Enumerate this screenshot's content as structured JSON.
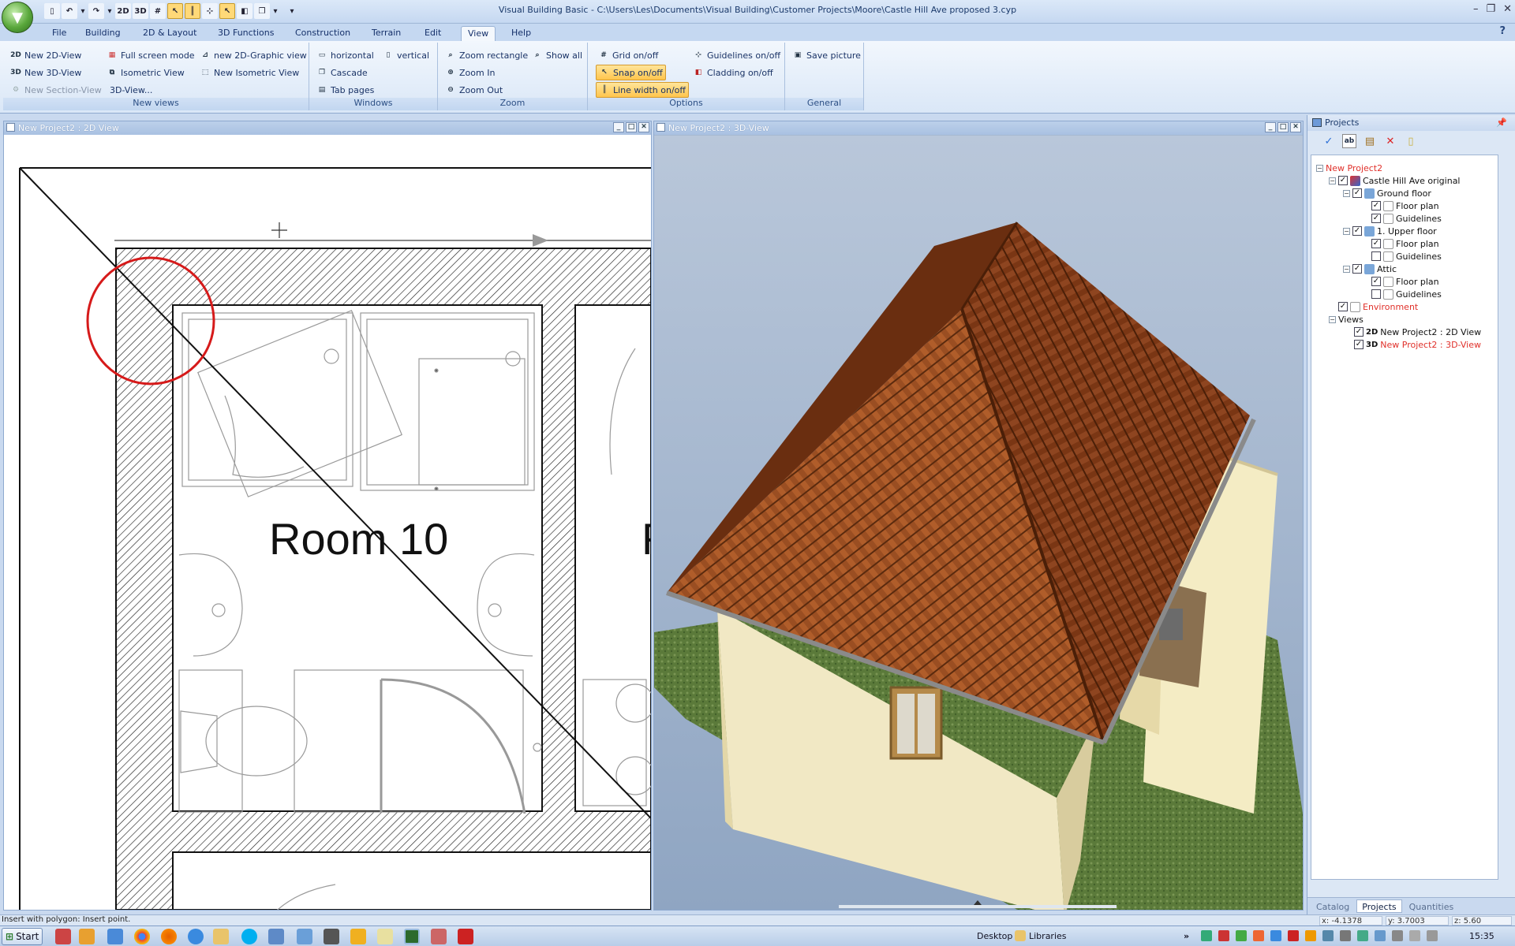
{
  "window": {
    "title": "Visual Building Basic - C:\\Users\\Les\\Documents\\Visual Building\\Customer Projects\\Moore\\Castle Hill Ave proposed 3.cyp"
  },
  "quick_access": [
    "new",
    "undo",
    "undo-arrow",
    "redo",
    "redo-arrow",
    "separator",
    "2D",
    "3D",
    "grid",
    "select-snap",
    "line-width",
    "measure",
    "pointer",
    "cladding",
    "copy",
    "copy-arrow",
    "customize"
  ],
  "menu_tabs": [
    "File",
    "Building",
    "2D & Layout",
    "3D Functions",
    "Construction",
    "Terrain",
    "Edit",
    "View",
    "Help"
  ],
  "active_tab": "View",
  "ribbon": {
    "new_views": {
      "label": "New views",
      "new_2d": "New 2D-View",
      "new_3d": "New 3D-View",
      "new_section": "New Section-View",
      "full_screen": "Full screen mode",
      "isometric": "Isometric View",
      "view_3d": "3D-View...",
      "new_2d_graphic": "new 2D-Graphic view",
      "new_isometric": "New Isometric View"
    },
    "windows": {
      "label": "Windows",
      "horizontal": "horizontal",
      "vertical": "vertical",
      "cascade": "Cascade",
      "tab_pages": "Tab pages"
    },
    "zoom": {
      "label": "Zoom",
      "zoom_rect": "Zoom rectangle",
      "show_all": "Show all",
      "zoom_in": "Zoom In",
      "zoom_out": "Zoom Out"
    },
    "options": {
      "label": "Options",
      "grid": "Grid on/off",
      "guidelines": "Guidelines on/off",
      "snap": "Snap on/off",
      "cladding": "Cladding on/off",
      "line_width": "Line width on/off"
    },
    "general": {
      "label": "General",
      "save_picture": "Save picture"
    }
  },
  "view2d": {
    "title": "New Project2 : 2D View",
    "room_label": "Room 10",
    "partial_label": "R"
  },
  "view3d": {
    "title": "New Project2 : 3D-View"
  },
  "projects": {
    "title": "Projects",
    "tree": {
      "root": "New Project2",
      "project": "Castle Hill Ave original",
      "ground_floor": "Ground floor",
      "upper_floor": "1. Upper floor",
      "attic": "Attic",
      "floor_plan": "Floor plan",
      "guidelines": "Guidelines",
      "environment": "Environment",
      "views": "Views",
      "view_2d_tag": "2D",
      "view_2d": "New Project2 : 2D View",
      "view_3d_tag": "3D",
      "view_3d": "New Project2 : 3D-View"
    },
    "tabs": [
      "Catalog",
      "Projects",
      "Quantities"
    ],
    "active_tab": "Projects"
  },
  "status": {
    "message": "Insert with polygon: Insert point.",
    "x": "x: -4.1378",
    "y": "y: 3.7003",
    "z": "z: 5.60"
  },
  "taskbar": {
    "start": "Start",
    "desktop": "Desktop",
    "libraries": "Libraries",
    "time": "15:35"
  },
  "colors": {
    "accent": "#ffc54d",
    "title_blue": "#1b3a6b",
    "tree_red": "#e0302a",
    "roof": "#8b4520",
    "wall": "#f1e8c4",
    "grass": "#5b7a3a",
    "sky": "#a6b9d1"
  }
}
